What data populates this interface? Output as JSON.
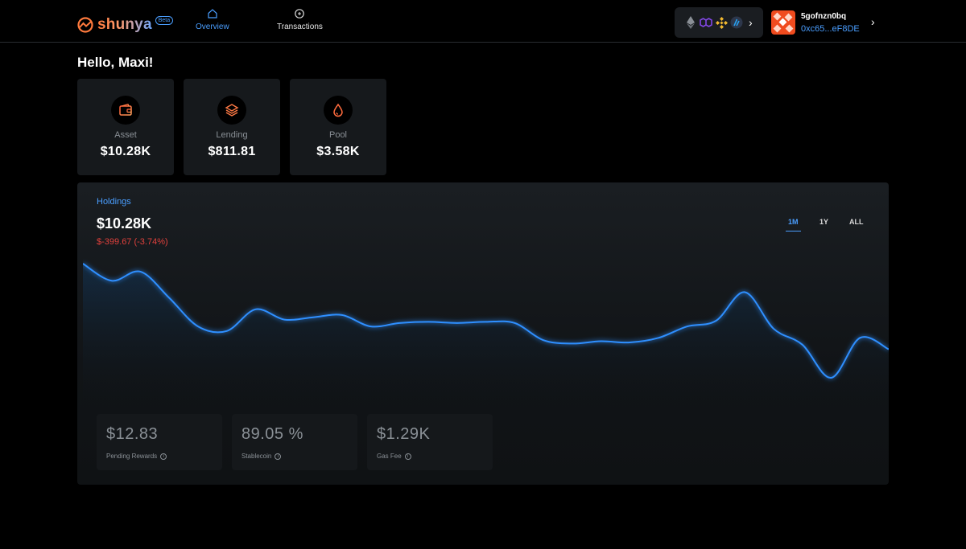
{
  "brand": {
    "name": "shunya",
    "badge": "Beta"
  },
  "nav": {
    "overview": "Overview",
    "transactions": "Transactions"
  },
  "account": {
    "name": "5gofnzn0bq",
    "address": "0xc65...eF8DE"
  },
  "chains": [
    "ethereum-icon",
    "polygon-icon",
    "bnb-icon",
    "arbitrum-icon"
  ],
  "greeting": "Hello, Maxi!",
  "stats": [
    {
      "label": "Asset",
      "value": "$10.28K",
      "icon": "wallet-icon"
    },
    {
      "label": "Lending",
      "value": "$811.81",
      "icon": "layers-icon"
    },
    {
      "label": "Pool",
      "value": "$3.58K",
      "icon": "drop-icon"
    }
  ],
  "holdings": {
    "title": "Holdings",
    "value": "$10.28K",
    "change": "$-399.67 (-3.74%)",
    "ranges": [
      "1M",
      "1Y",
      "ALL"
    ],
    "active_range": "1M"
  },
  "metrics": [
    {
      "value": "$12.83",
      "label": "Pending Rewards"
    },
    {
      "value": "89.05 %",
      "label": "Stablecoin"
    },
    {
      "value": "$1.29K",
      "label": "Gas Fee"
    }
  ],
  "chart_data": {
    "type": "area",
    "values": [
      10.85,
      10.7,
      10.78,
      10.55,
      10.3,
      10.26,
      10.45,
      10.36,
      10.38,
      10.4,
      10.3,
      10.33,
      10.34,
      10.33,
      10.34,
      10.33,
      10.18,
      10.15,
      10.17,
      10.16,
      10.2,
      10.3,
      10.35,
      10.6,
      10.28,
      10.14,
      9.85,
      10.2,
      10.1
    ],
    "colors": {
      "line": "#2f8fff",
      "fill_top": "#12385e"
    }
  }
}
